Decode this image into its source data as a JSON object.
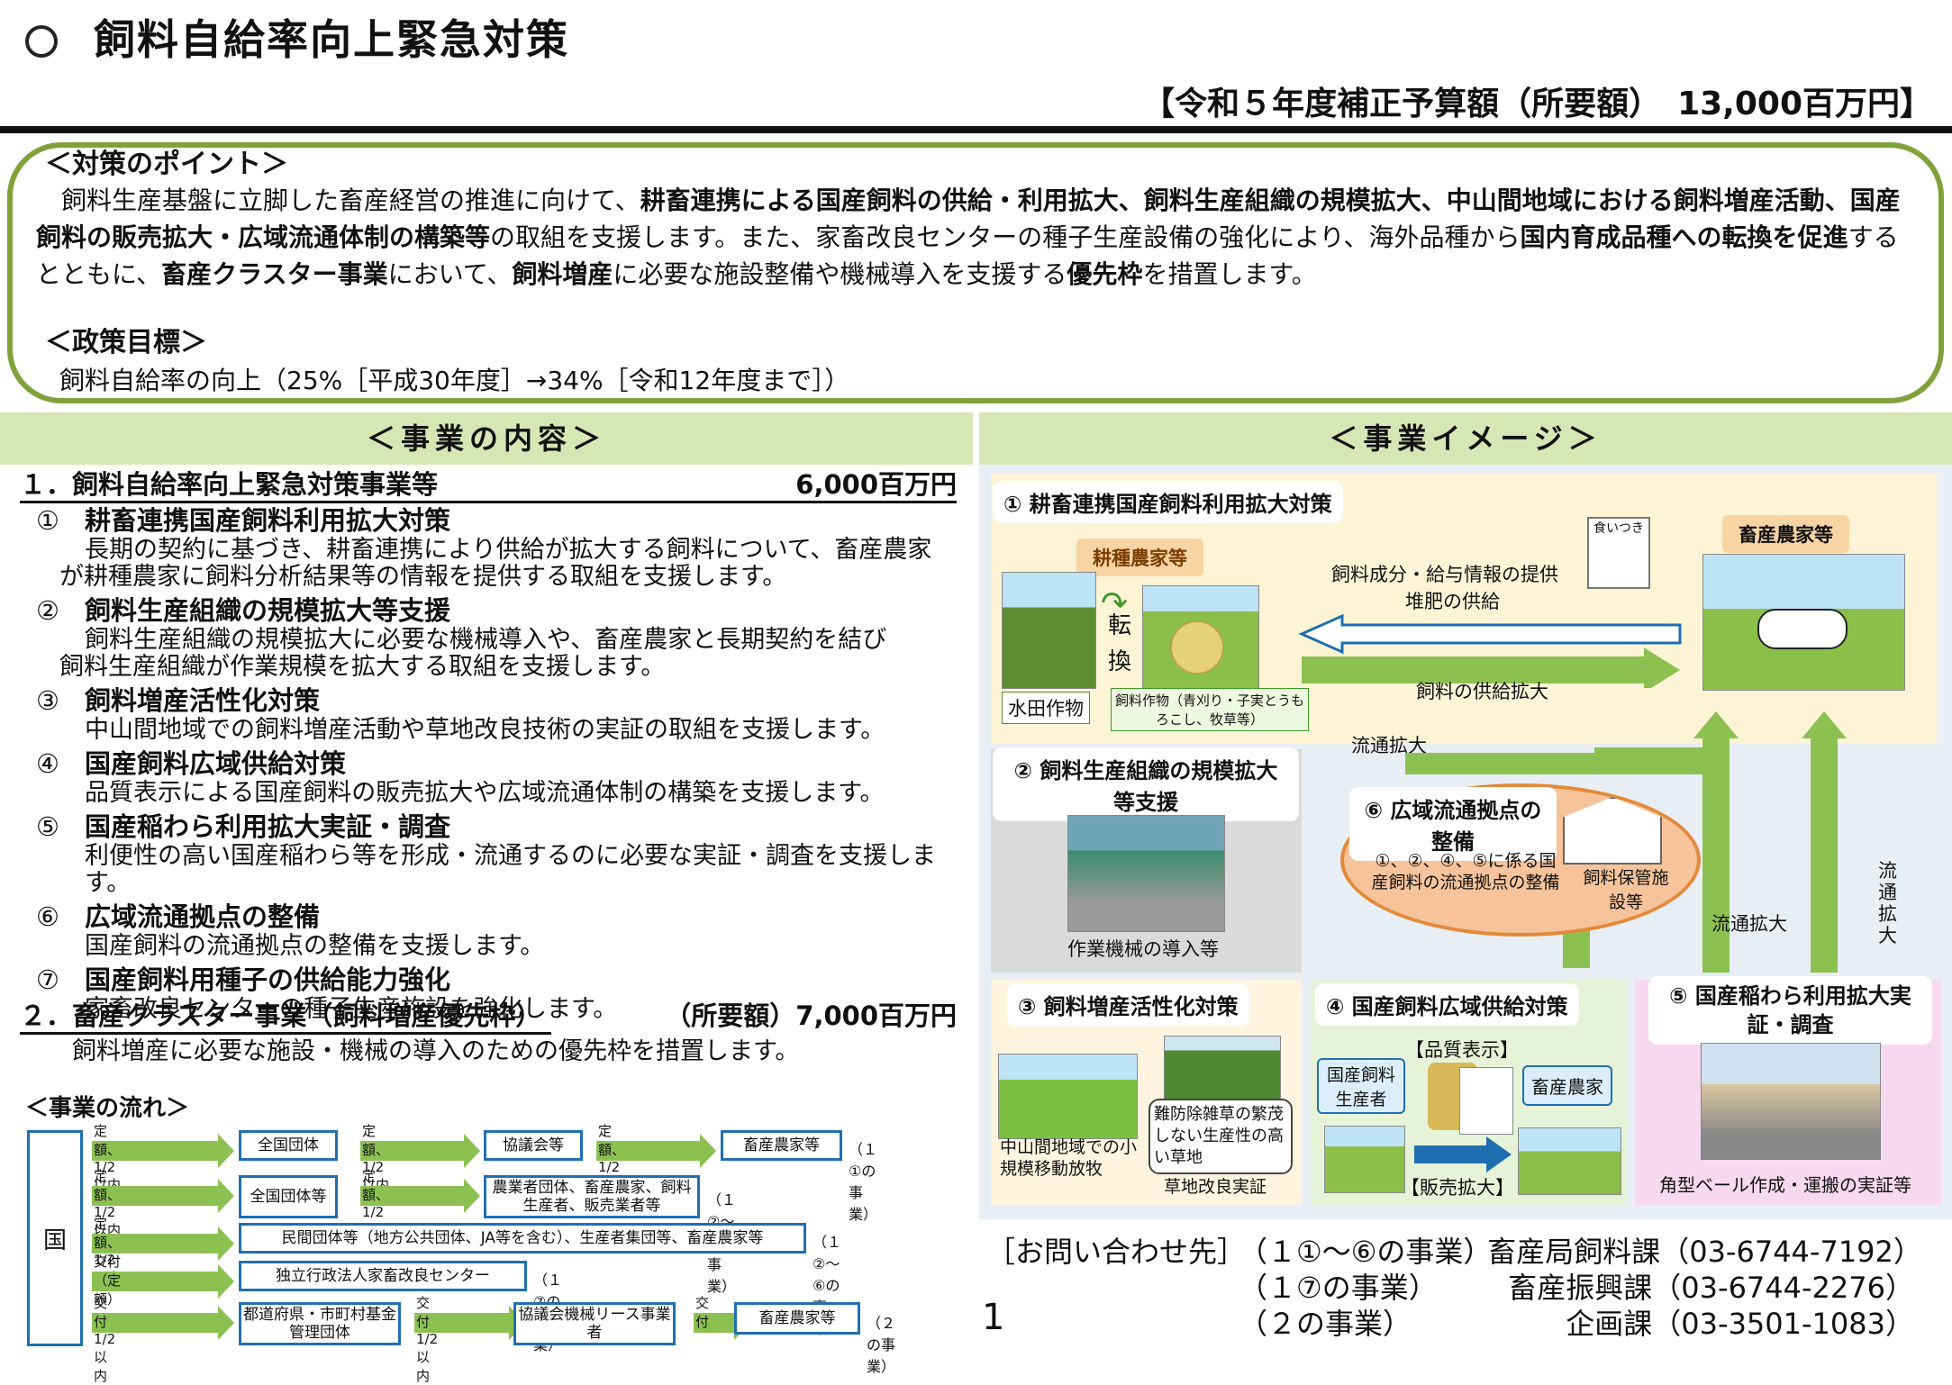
{
  "header": {
    "title": "飼料自給率向上緊急対策",
    "budget": "【令和５年度補正予算額（所要額）　13,000百万円】"
  },
  "points": {
    "heading": "＜対策のポイント＞",
    "body_html": "　飼料生産基盤に立脚した畜産経営の推進に向けて、<b>耕畜連携による国産飼料の供給・利用拡大、飼料生産組織の規模拡大、中山間地域における飼料増産活動、国産飼料の販売拡大・広域流通体制の構築等</b>の取組を支援します。また、家畜改良センターの種子生産設備の強化により、海外品種から<b>国内育成品種への転換を促進</b>するとともに、<b>畜産クラスター事業</b>において、<b>飼料増産</b>に必要な施設整備や機械導入を支援する<b>優先枠</b>を措置します。",
    "goal_heading": "＜政策目標＞",
    "goal_body": "飼料自給率の向上（25%［平成30年度］→34%［令和12年度まで］）"
  },
  "left": {
    "heading": "＜事業の内容＞",
    "s1": {
      "title": "１．飼料自給率向上緊急対策事業等",
      "amount": "6,000百万円"
    },
    "items": [
      {
        "no": "①",
        "title": "耕畜連携国産飼料利用拡大対策",
        "desc1": "長期の契約に基づき、耕畜連携により供給が拡大する飼料について、畜産農家",
        "desc2": "が耕種農家に飼料分析結果等の情報を提供する取組を支援します。"
      },
      {
        "no": "②",
        "title": "飼料生産組織の規模拡大等支援",
        "desc1": "飼料生産組織の規模拡大に必要な機械導入や、畜産農家と長期契約を結び",
        "desc2": "飼料生産組織が作業規模を拡大する取組を支援します。"
      },
      {
        "no": "③",
        "title": "飼料増産活性化対策",
        "desc1": "中山間地域での飼料増産活動や草地改良技術の実証の取組を支援します。",
        "desc2": ""
      },
      {
        "no": "④",
        "title": "国産飼料広域供給対策",
        "desc1": "品質表示による国産飼料の販売拡大や広域流通体制の構築を支援します。",
        "desc2": ""
      },
      {
        "no": "⑤",
        "title": "国産稲わら利用拡大実証・調査",
        "desc1": "利便性の高い国産稲わら等を形成・流通するのに必要な実証・調査を支援します。",
        "desc2": ""
      },
      {
        "no": "⑥",
        "title": "広域流通拠点の整備",
        "desc1": "国産飼料の流通拠点の整備を支援します。",
        "desc2": ""
      },
      {
        "no": "⑦",
        "title": "国産飼料用種子の供給能力強化",
        "desc1": "家畜改良センターの種子生産施設を強化します。",
        "desc2": ""
      }
    ],
    "s2": {
      "title": "２．畜産クラスター事業（飼料増産優先枠）",
      "amount": "（所要額）7,000百万円",
      "desc": "飼料増産に必要な施設・機械の導入のための優先枠を措置します。"
    },
    "flow": {
      "heading": "＜事業の流れ＞",
      "kuni": "国",
      "rows": [
        {
          "l1": "定額、1/2以内",
          "b1": "全国団体",
          "l2": "定額、1/2以内",
          "b2": "協議会等",
          "l3": "定額、1/2以内",
          "b3": "畜産農家等",
          "note": "（１①の事業）"
        },
        {
          "l1": "定額、1/2以内",
          "b1": "全国団体等",
          "l2": "定額、1/2以内",
          "b2": "農業者団体、畜産農家、飼料生産者、販売業者等",
          "note": "（１②～④の事業）"
        },
        {
          "l1": "定額、1/2以内",
          "b1": "民間団体等（地方公共団体、JA等を含む）、生産者集団等、畜産農家等",
          "note": "（１②～⑥の事業）"
        },
        {
          "l1": "交付（定額）",
          "b1": "独立行政法人家畜改良センター",
          "note": "（１⑦の事業）"
        },
        {
          "l1": "交付1/2以内",
          "b1": "都道府県・市町村基金管理団体",
          "l2": "交付1/2以内",
          "b2": "協議会機械リース事業者",
          "l3": "交付",
          "b3": "畜産農家等",
          "note": "（２の事業）"
        }
      ]
    }
  },
  "right": {
    "heading": "＜事業イメージ＞",
    "p1": {
      "title": "① 耕畜連携国産飼料利用拡大対策",
      "kouhu": "耕種農家等",
      "suiden": "水田作物",
      "tenkan": "転換",
      "crop": "飼料作物（青刈り・子実とうもろこし、牧草等）",
      "info": "飼料成分・給与情報の提供",
      "taihi": "堆肥の供給",
      "kyokyu": "飼料の供給拡大",
      "tag": "食いつき",
      "chikusan": "畜産農家等",
      "ryutsu": "流通拡大"
    },
    "p2": {
      "title": "② 飼料生産組織の規模拡大等支援",
      "cap": "作業機械の導入等"
    },
    "p6": {
      "title": "⑥ 広域流通拠点の整備",
      "desc": "①、②、④、⑤に係る国産飼料の流通拠点の整備",
      "hokan": "飼料保管施設等",
      "ryutsu": "流通拡大",
      "ryutsu_v": "流通拡大"
    },
    "p3": {
      "title": "③ 飼料増産活性化対策",
      "cap1": "中山間地域での小規模移動放牧",
      "cap2": "難防除雑草の繁茂しない生産性の高い草地",
      "cap3": "草地改良実証"
    },
    "p4": {
      "title": "④ 国産飼料広域供給対策",
      "hinshitsu": "【品質表示】",
      "seisansha": "国産飼料生産者",
      "nouka": "畜産農家",
      "hanbai": "【販売拡大】"
    },
    "p5": {
      "title": "⑤ 国産稲わら利用拡大実証・調査",
      "cap": "角型ベール作成・運搬の実証等"
    }
  },
  "contact": {
    "label": "［お問い合わせ先］",
    "page": "1",
    "rows": [
      {
        "scope": "（１①～⑥の事業）",
        "dept": "畜産局飼料課（03-6744-7192）"
      },
      {
        "scope": "（１⑦の事業）",
        "dept": "畜産振興課（03-6744-2276）"
      },
      {
        "scope": "（２の事業）",
        "dept": "企画課（03-3501-1083）"
      }
    ]
  },
  "colors": {
    "green": "#7fa23a",
    "header_green": "#d7e6b5",
    "blue": "#1f6fb0",
    "arrow": "#8cc152"
  }
}
